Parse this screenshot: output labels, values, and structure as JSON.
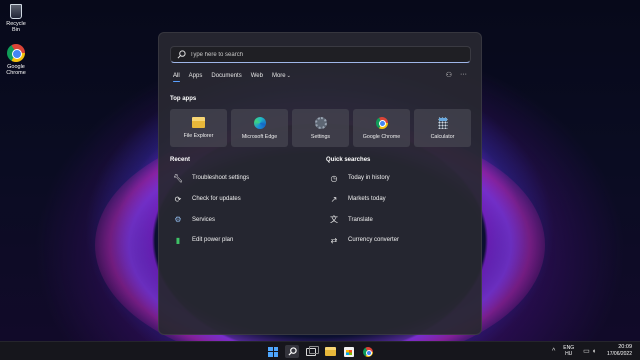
{
  "desktop": {
    "icons": [
      {
        "label": "Recycle Bin",
        "icon": "recycle-bin-icon"
      },
      {
        "label": "Google Chrome",
        "icon": "chrome-icon"
      }
    ]
  },
  "start_menu": {
    "search": {
      "placeholder": "Type here to search"
    },
    "tabs": [
      {
        "label": "All",
        "active": true
      },
      {
        "label": "Apps"
      },
      {
        "label": "Documents"
      },
      {
        "label": "Web"
      },
      {
        "label": "More"
      }
    ],
    "top_apps_title": "Top apps",
    "top_apps": [
      {
        "label": "File Explorer",
        "icon": "folder-icon"
      },
      {
        "label": "Microsoft Edge",
        "icon": "edge-icon"
      },
      {
        "label": "Settings",
        "icon": "gear-icon"
      },
      {
        "label": "Google Chrome",
        "icon": "chrome-icon"
      },
      {
        "label": "Calculator",
        "icon": "calculator-icon"
      }
    ],
    "recent_title": "Recent",
    "recent": [
      {
        "label": "Troubleshoot settings",
        "icon": "wrench-icon"
      },
      {
        "label": "Check for updates",
        "icon": "refresh-icon"
      },
      {
        "label": "Services",
        "icon": "gears-icon"
      },
      {
        "label": "Edit power plan",
        "icon": "battery-icon"
      }
    ],
    "quick_title": "Quick searches",
    "quick": [
      {
        "label": "Today in history",
        "icon": "clock-icon"
      },
      {
        "label": "Markets today",
        "icon": "chart-icon"
      },
      {
        "label": "Translate",
        "icon": "translate-icon"
      },
      {
        "label": "Currency converter",
        "icon": "exchange-icon"
      }
    ]
  },
  "taskbar": {
    "lang_line1": "ENG",
    "lang_line2": "HU",
    "time": "20:09",
    "date": "17/06/2022"
  },
  "colors": {
    "accent": "#4ea7ff",
    "panel": "#28282f",
    "taskbar": "#16161c"
  }
}
